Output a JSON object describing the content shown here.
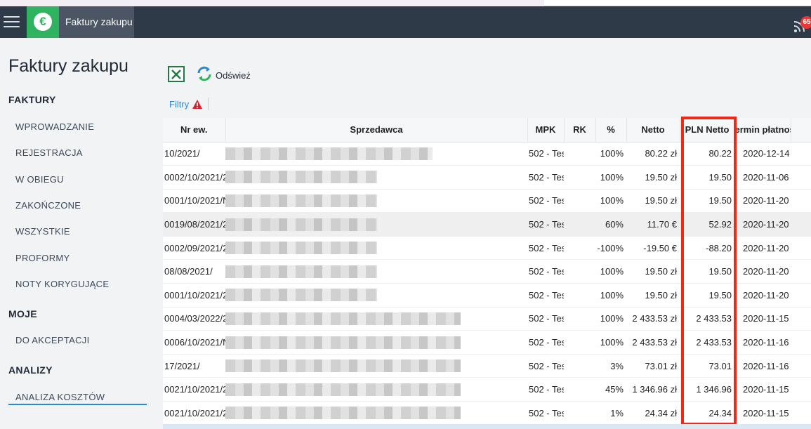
{
  "header": {
    "app_title": "Faktury zakupu",
    "notification_count": "65",
    "app_icon_symbol": "€"
  },
  "sidebar": {
    "page_title": "Faktury zakupu",
    "sections": [
      {
        "title": "FAKTURY",
        "items": [
          "WPROWADZANIE",
          "REJESTRACJA",
          "W OBIEGU",
          "ZAKOŃCZONE",
          "WSZYSTKIE",
          "PROFORMY",
          "NOTY KORYGUJĄCE"
        ]
      },
      {
        "title": "MOJE",
        "items": [
          "DO AKCEPTACJI"
        ]
      },
      {
        "title": "ANALIZY",
        "items": [
          "ANALIZA KOSZTÓW"
        ]
      }
    ],
    "active_item": "ANALIZA KOSZTÓW"
  },
  "toolbar": {
    "excel_icon": "excel-export-icon",
    "refresh_label": "Odśwież",
    "filters_label": "Filtry"
  },
  "table": {
    "columns": [
      "Nr ew.",
      "Sprzedawca",
      "MPK",
      "RK",
      "%",
      "Netto",
      "PLN Netto",
      "Termin płatności"
    ],
    "columns_visible_text": [
      "Nr ew.",
      "Sprzedawca",
      "MPK",
      "RK",
      "%",
      "Netto",
      "PLN Netto",
      "ermin płatnoś"
    ],
    "rows": [
      {
        "nr": "10/2021/",
        "mpk": "502 - Tes -",
        "pct": "100%",
        "netto": "80.22 zł",
        "pln": "80.22",
        "termin": "2020-12-14 -"
      },
      {
        "nr": "0002/10/2021/2",
        "mpk": "502 - Tes -",
        "pct": "100%",
        "netto": "19.50 zł",
        "pln": "19.50",
        "termin": "2020-11-06 -"
      },
      {
        "nr": "0001/10/2021/N",
        "mpk": "502 - Tes -",
        "pct": "100%",
        "netto": "19.50 zł",
        "pln": "19.50",
        "termin": "2020-11-20 -"
      },
      {
        "nr": "0019/08/2021/2",
        "mpk": "502 - Tes -",
        "pct": "60%",
        "netto": "11.70 €",
        "pln": "52.92",
        "termin": "2020-11-20 -"
      },
      {
        "nr": "0002/09/2021/2",
        "mpk": "502 - Tes -",
        "pct": "-100%",
        "netto": "-19.50 €",
        "pln": "-88.20",
        "termin": "2020-11-20 -"
      },
      {
        "nr": "08/08/2021/",
        "mpk": "502 - Tes -",
        "pct": "100%",
        "netto": "19.50 zł",
        "pln": "19.50",
        "termin": "2020-11-20 -"
      },
      {
        "nr": "0001/10/2021/2",
        "mpk": "502 - Tes -",
        "pct": "100%",
        "netto": "19.50 zł",
        "pln": "19.50",
        "termin": "2020-11-20 -"
      },
      {
        "nr": "0004/03/2022/2",
        "mpk": "502 - Tes -",
        "pct": "100%",
        "netto": "2 433.53 zł",
        "pln": "2 433.53",
        "termin": "2020-11-15 -"
      },
      {
        "nr": "0006/10/2021/N",
        "mpk": "502 - Tes -",
        "pct": "100%",
        "netto": "2 433.53 zł",
        "pln": "2 433.53",
        "termin": "2020-11-16 -"
      },
      {
        "nr": "17/2021/",
        "mpk": "502 - Tes -",
        "pct": "3%",
        "netto": "73.01 zł",
        "pln": "73.01",
        "termin": "2020-11-16 -"
      },
      {
        "nr": "0021/10/2021/2",
        "mpk": "502 - Tes -",
        "pct": "45%",
        "netto": "1 346.96 zł",
        "pln": "1 346.96",
        "termin": "2020-11-15 -"
      },
      {
        "nr": "0021/10/2021/2",
        "mpk": "502 - Tes -",
        "pct": "1%",
        "netto": "24.34 zł",
        "pln": "24.34",
        "termin": "2020-11-15 -"
      }
    ],
    "highlighted_column": "PLN Netto",
    "highlight_color": "#ee2a17"
  },
  "colors": {
    "topbar": "#2f3a48",
    "accent_green": "#2fb361",
    "link_blue": "#2f85d6"
  }
}
